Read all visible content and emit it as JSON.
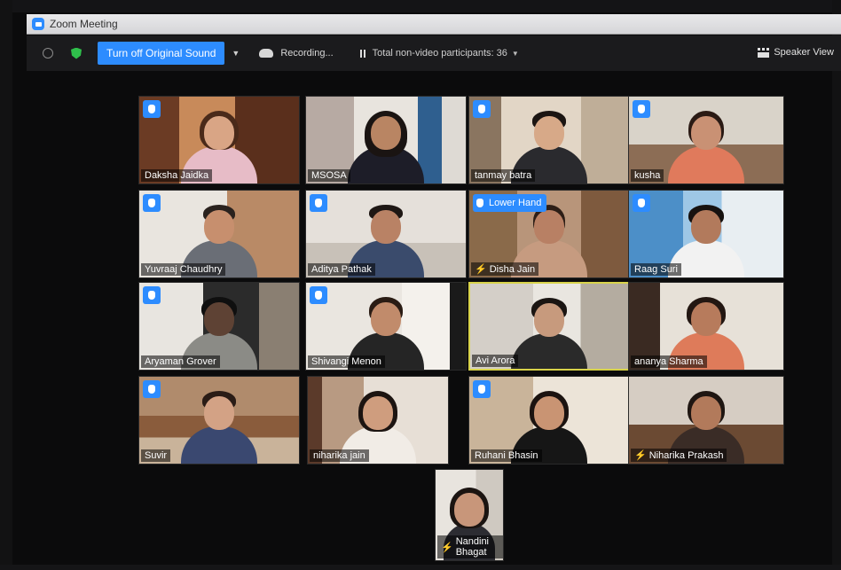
{
  "window": {
    "title": "Zoom Meeting"
  },
  "toolbar": {
    "original_sound_label": "Turn off Original Sound",
    "recording_label": "Recording...",
    "non_video_label": "Total non-video participants: 36",
    "speaker_view_label": "Speaker View"
  },
  "icons": {
    "info": "info-icon",
    "encryption": "shield-icon",
    "recording": "cloud-recording-icon",
    "pause": "pause-icon",
    "raised_hand": "raised-hand-icon",
    "muted": "mic-off-icon",
    "layout": "grid-icon"
  },
  "colors": {
    "accent": "#2d8cff",
    "active_speaker": "#d8d34a",
    "muted": "#ff4a36"
  },
  "lower_hand_label": "Lower Hand",
  "participants": [
    {
      "name": "Daksha Jaidka",
      "hand": true,
      "muted": false
    },
    {
      "name": "MSOSA",
      "hand": false,
      "muted": false
    },
    {
      "name": "tanmay batra",
      "hand": true,
      "muted": false
    },
    {
      "name": "kusha",
      "hand": true,
      "muted": false
    },
    {
      "name": "Yuvraaj Chaudhry",
      "hand": true,
      "muted": false
    },
    {
      "name": "Aditya Pathak",
      "hand": true,
      "muted": false
    },
    {
      "name": "Disha Jain",
      "hand": false,
      "muted": true
    },
    {
      "name": "Raag Suri",
      "hand": true,
      "muted": false
    },
    {
      "name": "Aryaman Grover",
      "hand": true,
      "muted": false
    },
    {
      "name": "Shivangi Menon",
      "hand": true,
      "muted": false
    },
    {
      "name": "Avi Arora",
      "hand": false,
      "muted": false
    },
    {
      "name": "ananya Sharma",
      "hand": false,
      "muted": false
    },
    {
      "name": "Suvir",
      "hand": true,
      "muted": false
    },
    {
      "name": "niharika jain",
      "hand": false,
      "muted": false
    },
    {
      "name": "Ruhani Bhasin",
      "hand": true,
      "muted": false
    },
    {
      "name": "Niharika Prakash",
      "hand": false,
      "muted": true
    },
    {
      "name": "Nandini Bhagat",
      "hand": false,
      "muted": true
    }
  ]
}
